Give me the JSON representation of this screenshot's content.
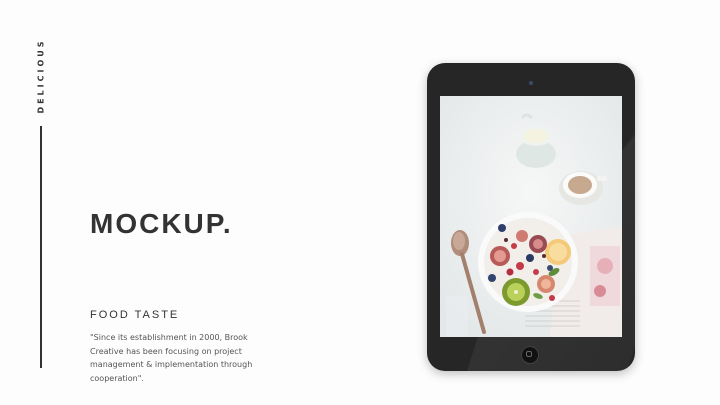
{
  "side_label": "DELICIOUS",
  "title": "MOCKUP.",
  "subtitle": "FOOD TASTE",
  "description": "\"Since its establishment in 2000, Brook Creative has been focusing on project management & implementation through cooperation\".",
  "device": {
    "photo_icon": "food-photo-icon"
  },
  "colors": {
    "background": "#fdfdfd",
    "text": "#333333",
    "device": "#262626"
  }
}
